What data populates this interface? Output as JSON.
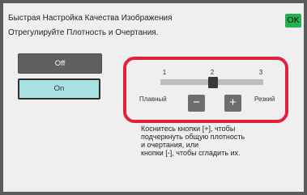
{
  "header": {
    "title_line1": "Быстрая Настройка Качества Изображения",
    "title_line2": "Отрегулируйте Плотность и Очертания.",
    "ok_label": "OK"
  },
  "mode": {
    "off_label": "Off",
    "on_label": "On",
    "selected": "On"
  },
  "slider": {
    "ticks": [
      "1",
      "2",
      "3"
    ],
    "value": 2,
    "min": 1,
    "max": 3,
    "left_label": "Плавный",
    "right_label": "Резкий",
    "minus_label": "−",
    "plus_label": "+"
  },
  "help": {
    "line1": "Коснитесь кнопки [+], чтобы",
    "line2": "подчеркнуть общую плотность",
    "line3": "и очертания, или",
    "line4": "кнопки [-], чтобы сгладить их."
  },
  "colors": {
    "ok": "#22b14c",
    "highlight": "#e2203f",
    "on_selected": "#a9e0e2"
  }
}
